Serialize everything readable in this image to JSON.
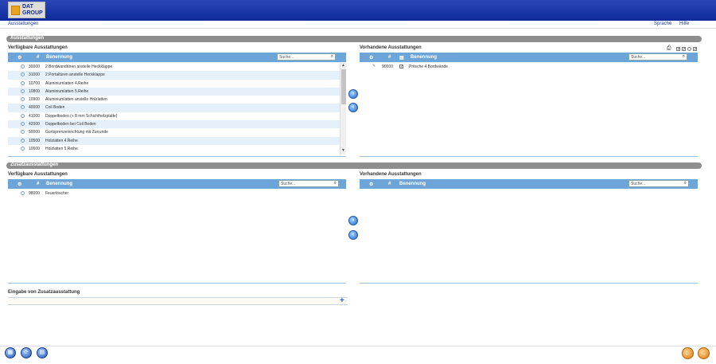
{
  "app": {
    "logo_line1": "DAT",
    "logo_line2": "GROUP"
  },
  "nav": {
    "left_link": "Ausstattungen",
    "right_links": [
      "Sprache",
      "Hilfe"
    ]
  },
  "section1": {
    "title": "Ausstattungen",
    "left": {
      "panel_title": "Verfügbare Ausstattungen",
      "columns": [
        "#",
        "Benennung"
      ],
      "search_placeholder": "Suche...",
      "rows": [
        {
          "code": "30000",
          "name": "2 Bordwandtüren anstelle Heckklappe"
        },
        {
          "code": "31000",
          "name": "2 Portaltüren anstelle Heckklappe"
        },
        {
          "code": "10700",
          "name": "Aluminiumlatten 4.Reihe"
        },
        {
          "code": "10800",
          "name": "Aluminiumlatten 5.Reihe"
        },
        {
          "code": "10900",
          "name": "Aluminiumlatten anstelle Holzlatten"
        },
        {
          "code": "40000",
          "name": "Coil Boden"
        },
        {
          "code": "41000",
          "name": "Doppelboden (+ 8 mm Schichtholzplatte)"
        },
        {
          "code": "42000",
          "name": "Doppelboden bei Coil Boden"
        },
        {
          "code": "50000",
          "name": "Gurtsprenzeinrichtung mit Zurrunde"
        },
        {
          "code": "10500",
          "name": "Holzlatten 4.Reihe"
        },
        {
          "code": "10600",
          "name": "Holzlatten 5.Reihe"
        }
      ]
    },
    "right": {
      "panel_title": "Vorhandene Ausstattungen",
      "columns": [
        "#",
        "Benennung"
      ],
      "search_placeholder": "Suche...",
      "rows": [
        {
          "code": "90000",
          "name": "Pritsche 4 Bordwände"
        }
      ]
    }
  },
  "section2": {
    "title": "Zusatzausstattungen",
    "left": {
      "panel_title": "Verfügbare Ausstattungen",
      "columns": [
        "#",
        "Benennung"
      ],
      "search_placeholder": "Suche...",
      "rows": [
        {
          "code": "98000",
          "name": "Feuerlöscher"
        }
      ]
    },
    "right": {
      "panel_title": "Vorhandene Ausstattungen",
      "columns": [
        "#",
        "Benennung"
      ],
      "search_placeholder": "Suche..."
    },
    "custom_label": "Eingabe von Zusatzausstattung"
  }
}
